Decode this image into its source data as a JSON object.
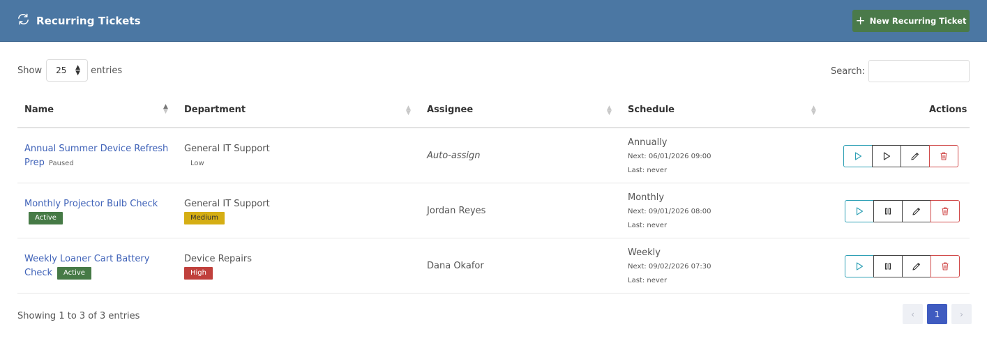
{
  "header": {
    "title": "Recurring Tickets",
    "icon": "recurring-icon",
    "new_button_label": "New Recurring Ticket",
    "colors": {
      "bar": "#4b77a3",
      "new_button": "#4a7a4a"
    }
  },
  "controls": {
    "show_label": "Show",
    "entries_label": "entries",
    "page_size": "25",
    "search_label": "Search:",
    "search_value": ""
  },
  "table": {
    "columns": [
      "Name",
      "Department",
      "Assignee",
      "Schedule",
      "Actions"
    ],
    "sorted_column": "Name",
    "rows": [
      {
        "name": "Annual Summer Device Refresh Prep",
        "status": "Paused",
        "department": "General IT Support",
        "priority": "Low",
        "assignee": "Auto-assign",
        "frequency": "Annually",
        "next": "Next: 06/01/2026 09:00",
        "last": "Last: never",
        "toggle_icon": "play-icon"
      },
      {
        "name": "Monthly Projector Bulb Check",
        "status": "Active",
        "department": "General IT Support",
        "priority": "Medium",
        "assignee": "Jordan Reyes",
        "frequency": "Monthly",
        "next": "Next: 09/01/2026 08:00",
        "last": "Last: never",
        "toggle_icon": "pause-icon"
      },
      {
        "name": "Weekly Loaner Cart Battery Check",
        "status": "Active",
        "department": "Device Repairs",
        "priority": "High",
        "assignee": "Dana Okafor",
        "frequency": "Weekly",
        "next": "Next: 09/02/2026 07:30",
        "last": "Last: never",
        "toggle_icon": "pause-icon"
      }
    ]
  },
  "footer": {
    "info": "Showing 1 to 3 of 3 entries",
    "current_page": "1",
    "prev_label": "‹",
    "next_label": "›"
  },
  "colors": {
    "priority_medium": "#d5ae14",
    "priority_high": "#c0403c",
    "status_active": "#467a46",
    "link": "#3f62b8",
    "page_current": "#3f5bc0"
  }
}
